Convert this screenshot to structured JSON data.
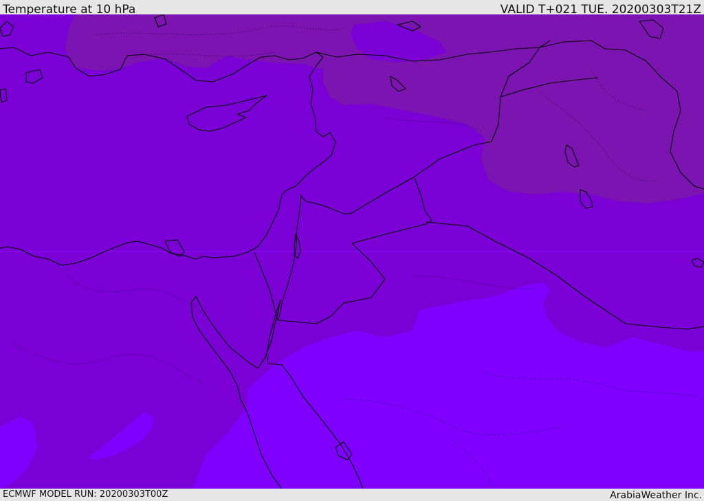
{
  "header": {
    "title": "Temperature at 10 hPa",
    "valid": "VALID T+021 TUE. 20200303T21Z"
  },
  "footer": {
    "model_run": "ECMWF MODEL RUN: 20200303T00Z",
    "credit": "ArabiaWeather Inc."
  },
  "map": {
    "field": "temperature",
    "level": "10 hPa",
    "colors": {
      "base": "#7a00d6",
      "warm_region": "#7c14b2",
      "cool_region": "#7f00ff",
      "light_band": "#8a0cf6",
      "borders": "#000000"
    }
  }
}
